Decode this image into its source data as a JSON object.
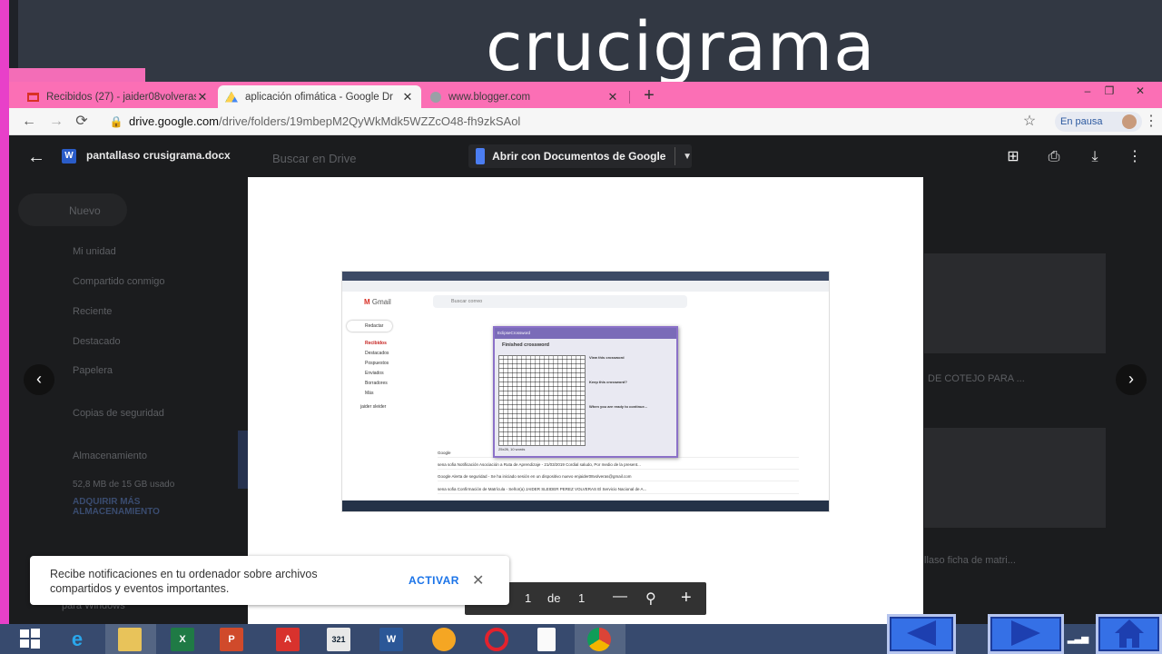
{
  "slide": {
    "title": "crucigrama"
  },
  "browser": {
    "tabs": [
      {
        "label": "Recibidos (27) - jaider08volveras",
        "favicon": "gmail-icon",
        "close": "✕"
      },
      {
        "label": "aplicación ofimática - Google Dr",
        "favicon": "google-drive-icon",
        "close": "✕"
      },
      {
        "label": "www.blogger.com",
        "favicon": "globe-icon",
        "close": "✕"
      }
    ],
    "new_tab": "+",
    "window_controls": {
      "minimize": "–",
      "maximize": "❐",
      "close": "✕"
    },
    "url_prefix": "drive.google.com",
    "url_path": "/drive/folders/19mbepM2QyWkMdk5WZZcO48-fh9zkSAol",
    "profile_label": "En pausa"
  },
  "drive": {
    "search_placeholder": "Buscar en Drive",
    "new_button": "Nuevo",
    "sidebar": [
      "Mi unidad",
      "Compartido conmigo",
      "Reciente",
      "Destacado",
      "Papelera",
      "Copias de seguridad",
      "Almacenamiento"
    ],
    "storage_used": "52,8 MB de 15 GB usado",
    "buy_storage": "ADQUIRIR MÁS ALMACENAMIENTO",
    "right_file_1": "DE COTEJO PARA ...",
    "right_file_2": "llaso ficha de matri...",
    "windows_label": "para Windows"
  },
  "preview": {
    "file_name": "pantallaso crusigrama.docx",
    "file_badge": "W",
    "open_with": "Abrir con Documentos de Google",
    "page_label": "de",
    "current_page": "1",
    "total_pages": "1",
    "zoom_out": "—",
    "zoom_in": "+"
  },
  "embedded_screenshot": {
    "gmail_logo": "Gmail",
    "search": "Buscar correo",
    "compose": "Redactar",
    "sidebar": [
      "Recibidos",
      "Destacados",
      "Pospuestos",
      "Enviados",
      "Borradores",
      "Más"
    ],
    "user": "jaider sleider",
    "rows": [
      "Google",
      "sena sofia   Notificación Asociación a Ruta de Aprendizaje - 21/03/2019 Cordial saludo, Por medio de la present...",
      "Google   Alerta de seguridad - Se ha iniciado sesión en un dispositivo nuevo enjaider08volveras@gmail.com",
      "sena sofia   Confirmación de Matrícula - Señor(a) JAIDER SLEIDER PEREZ VOLVERAS El Servicio Nacional de A..."
    ],
    "dialog": {
      "title": "EclipseCrossword",
      "heading": "Finished crossword",
      "view": "View this crossword",
      "keep": "Keep this crossword?",
      "ready": "When you are ready to continue...",
      "footer": "25x26, 10 words"
    }
  },
  "toast": {
    "message": "Recibe notificaciones en tu ordenador sobre archivos compartidos y eventos importantes.",
    "action": "ACTIVAR",
    "close": "✕"
  },
  "taskbar": {
    "apps": [
      "windows-start",
      "internet-explorer",
      "file-explorer",
      "excel",
      "powerpoint",
      "pdf-reader",
      "media-player",
      "word",
      "firefox",
      "opera",
      "notepad",
      "chrome"
    ]
  },
  "colors": {
    "slide_accent": "#e840c9",
    "tab_bar": "#fb6fb5",
    "slide_button": "#3570e6"
  }
}
